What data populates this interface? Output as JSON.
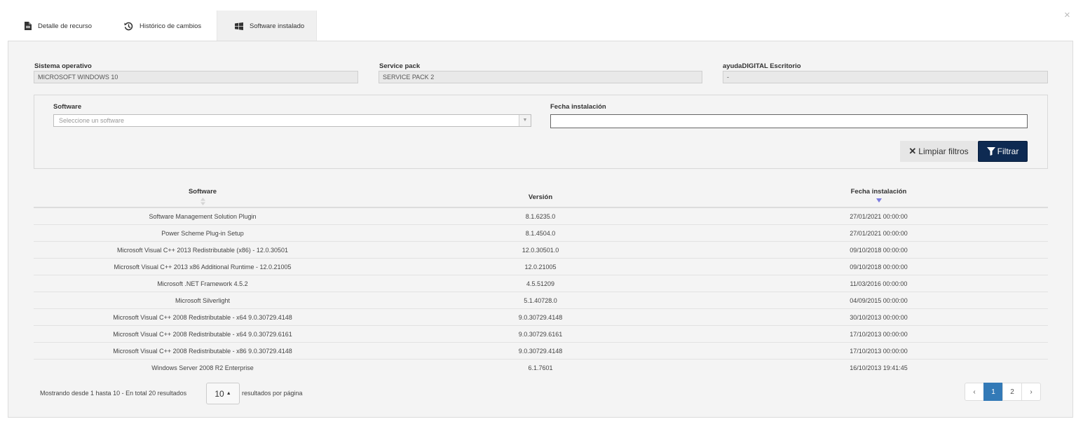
{
  "tabs": [
    {
      "label": "Detalle de recurso",
      "icon": "document-icon"
    },
    {
      "label": "Histórico de cambios",
      "icon": "history-icon"
    },
    {
      "label": "Software instalado",
      "icon": "windows-icon",
      "active": true
    }
  ],
  "close_label": "×",
  "info": {
    "os": {
      "label": "Sistema operativo",
      "value": "MICROSOFT WINDOWS 10"
    },
    "service_pack": {
      "label": "Service pack",
      "value": "SERVICE PACK 2"
    },
    "desktop": {
      "label": "ayudaDIGITAL Escritorio",
      "value": "-"
    }
  },
  "filters": {
    "software_label": "Software",
    "software_placeholder": "Seleccione un software",
    "date_label": "Fecha instalación",
    "date_value": "",
    "clear_label": "Limpiar filtros",
    "filter_label": "Filtrar"
  },
  "table": {
    "headers": [
      "Software",
      "Versión",
      "Fecha instalación"
    ],
    "rows": [
      [
        "Software Management Solution Plugin",
        "8.1.6235.0",
        "27/01/2021 00:00:00"
      ],
      [
        "Power Scheme Plug-in Setup",
        "8.1.4504.0",
        "27/01/2021 00:00:00"
      ],
      [
        "Microsoft Visual C++ 2013 Redistributable (x86) - 12.0.30501",
        "12.0.30501.0",
        "09/10/2018 00:00:00"
      ],
      [
        "Microsoft Visual C++ 2013 x86 Additional Runtime - 12.0.21005",
        "12.0.21005",
        "09/10/2018 00:00:00"
      ],
      [
        "Microsoft .NET Framework 4.5.2",
        "4.5.51209",
        "11/03/2016 00:00:00"
      ],
      [
        "Microsoft Silverlight",
        "5.1.40728.0",
        "04/09/2015 00:00:00"
      ],
      [
        "Microsoft Visual C++ 2008 Redistributable - x64 9.0.30729.4148",
        "9.0.30729.4148",
        "30/10/2013 00:00:00"
      ],
      [
        "Microsoft Visual C++ 2008 Redistributable - x64 9.0.30729.6161",
        "9.0.30729.6161",
        "17/10/2013 00:00:00"
      ],
      [
        "Microsoft Visual C++ 2008 Redistributable - x86 9.0.30729.4148",
        "9.0.30729.4148",
        "17/10/2013 00:00:00"
      ],
      [
        "Windows Server 2008 R2 Enterprise",
        "6.1.7601",
        "16/10/2013 19:41:45"
      ]
    ]
  },
  "footer": {
    "showing": "Mostrando desde 1 hasta 10 - En total 20 resultados",
    "per_page": "10",
    "per_page_suffix": "resultados por página",
    "pages": [
      "1",
      "2"
    ],
    "prev": "‹",
    "next": "›",
    "current_page": "1"
  },
  "colors": {
    "primary_button": "#0e2a52",
    "active_page": "#337ab7",
    "sort_indicator": "#7b7be0"
  }
}
